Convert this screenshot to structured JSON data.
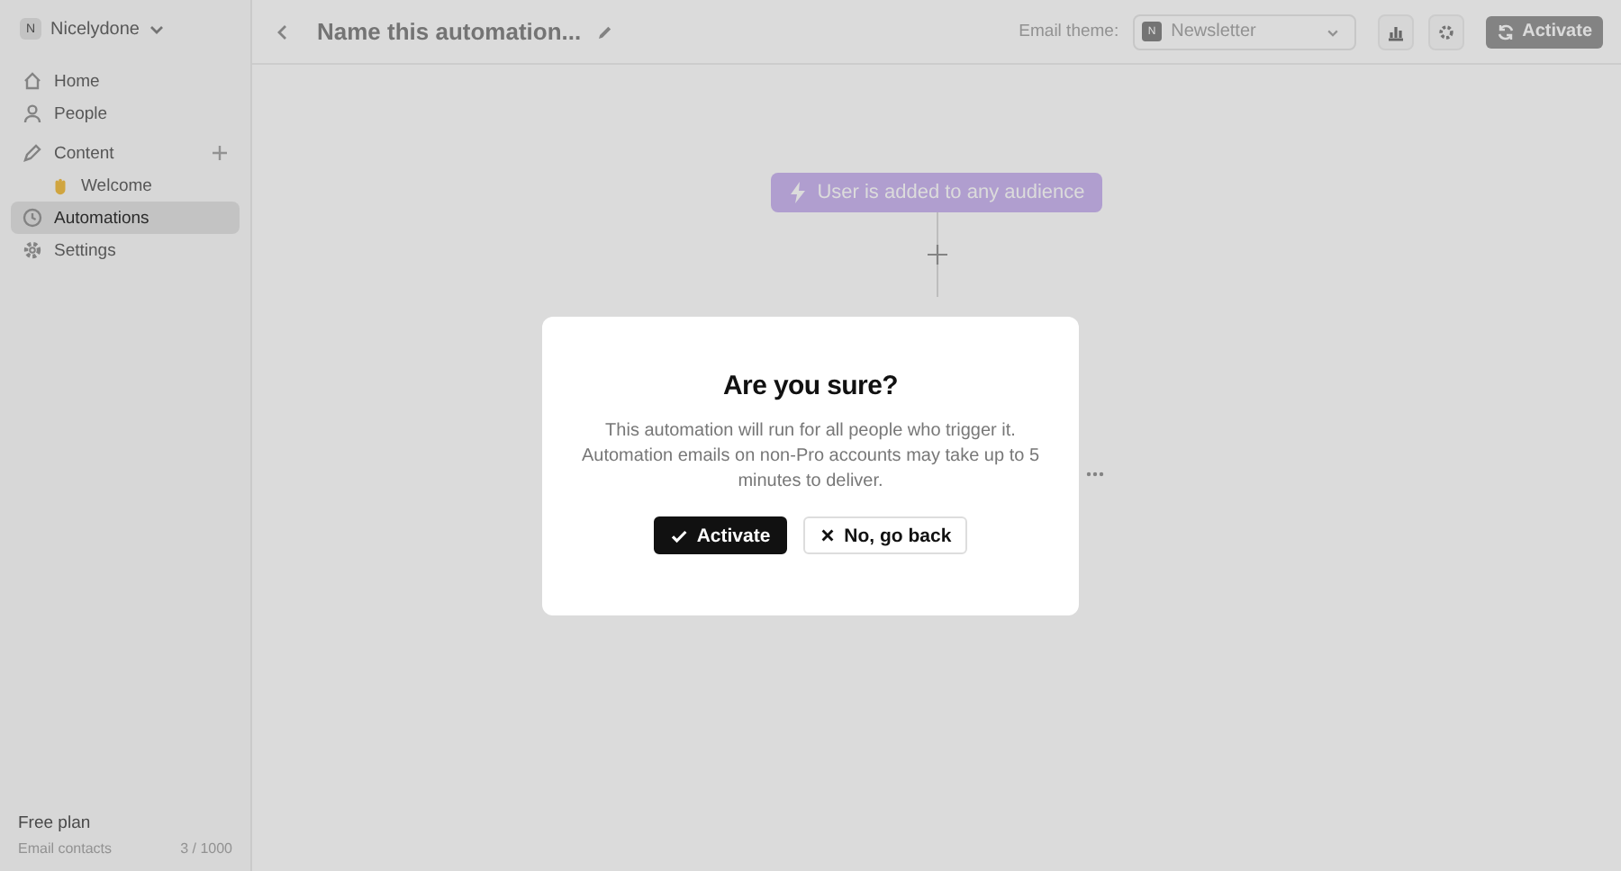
{
  "sidebar": {
    "workspace": {
      "initial": "N",
      "name": "Nicelydone"
    },
    "items": [
      {
        "kind": "home",
        "label": "Home",
        "selected": false
      },
      {
        "kind": "people",
        "label": "People",
        "selected": false
      },
      {
        "kind": "content",
        "label": "Content",
        "selected": false,
        "children": [
          {
            "label": "Welcome",
            "selected": false
          }
        ]
      },
      {
        "kind": "automations",
        "label": "Automations",
        "selected": true
      },
      {
        "kind": "settings",
        "label": "Settings",
        "selected": false
      }
    ],
    "plan": {
      "name": "Free plan",
      "label": "Email contacts",
      "count": "3 / 1000"
    }
  },
  "header": {
    "title": "Name this automation...",
    "theme_label": "Email theme:",
    "theme": {
      "initial": "N",
      "value": "Newsletter"
    },
    "activate": "Activate"
  },
  "canvas": {
    "trigger": "User is added to any audience"
  },
  "dialog": {
    "title": "Are you sure?",
    "message": "This automation will run for all people who trigger it. Automation emails on non-Pro accounts may take up to 5 minutes to deliver.",
    "buttons": [
      {
        "kind": "confirm",
        "label": "Activate"
      },
      {
        "kind": "cancel",
        "label": "No, go back"
      }
    ]
  }
}
